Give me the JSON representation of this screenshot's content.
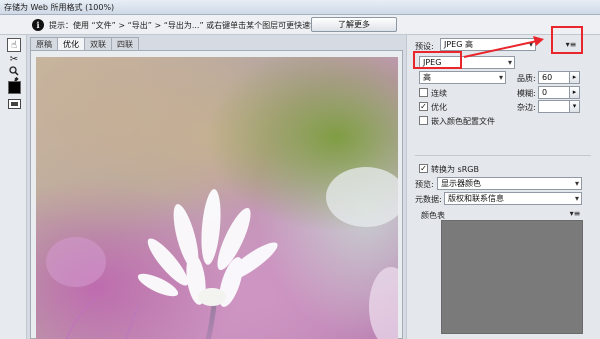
{
  "window": {
    "title": "存储为 Web 所用格式 (100%)"
  },
  "infobar": {
    "icon": "info-icon",
    "icon_glyph": "i",
    "tip": "提示：使用 “文件” > “导出” > “导出为...” 或右键单击某个图层可更快速地导出资源",
    "learn_more": "了解更多"
  },
  "tools": [
    {
      "name": "hand-tool-icon",
      "glyph": "☝",
      "active": true
    },
    {
      "name": "slice-select-tool-icon",
      "glyph": "✂",
      "active": false
    },
    {
      "name": "zoom-tool-icon",
      "glyph": "🔍︎",
      "active": false
    },
    {
      "name": "eyedropper-tool-icon",
      "glyph": "✒",
      "active": false
    }
  ],
  "tabs": [
    "原稿",
    "优化",
    "双联",
    "四联"
  ],
  "active_tab": 1,
  "settings": {
    "preset_label": "预设:",
    "preset_value": "JPEG 高",
    "format_value": "JPEG",
    "quality_preset": "高",
    "quality_label": "品质:",
    "quality_value": "60",
    "blur_label": "模糊:",
    "blur_value": "0",
    "matte_label": "杂边:",
    "progressive_label": "连续",
    "progressive_checked": false,
    "optimized_label": "优化",
    "optimized_checked": true,
    "embed_profile_label": "嵌入颜色配置文件",
    "embed_profile_checked": false,
    "convert_srgb_label": "转换为 sRGB",
    "convert_srgb_checked": true,
    "preview_label": "预览:",
    "preview_value": "显示器颜色",
    "metadata_label": "元数据:",
    "metadata_value": "版权和联系信息",
    "color_table_label": "颜色表",
    "menu_glyph": "▾≡"
  },
  "colors": {
    "highlight": "#e8262b",
    "color_table_bg": "#7a7a7a"
  }
}
